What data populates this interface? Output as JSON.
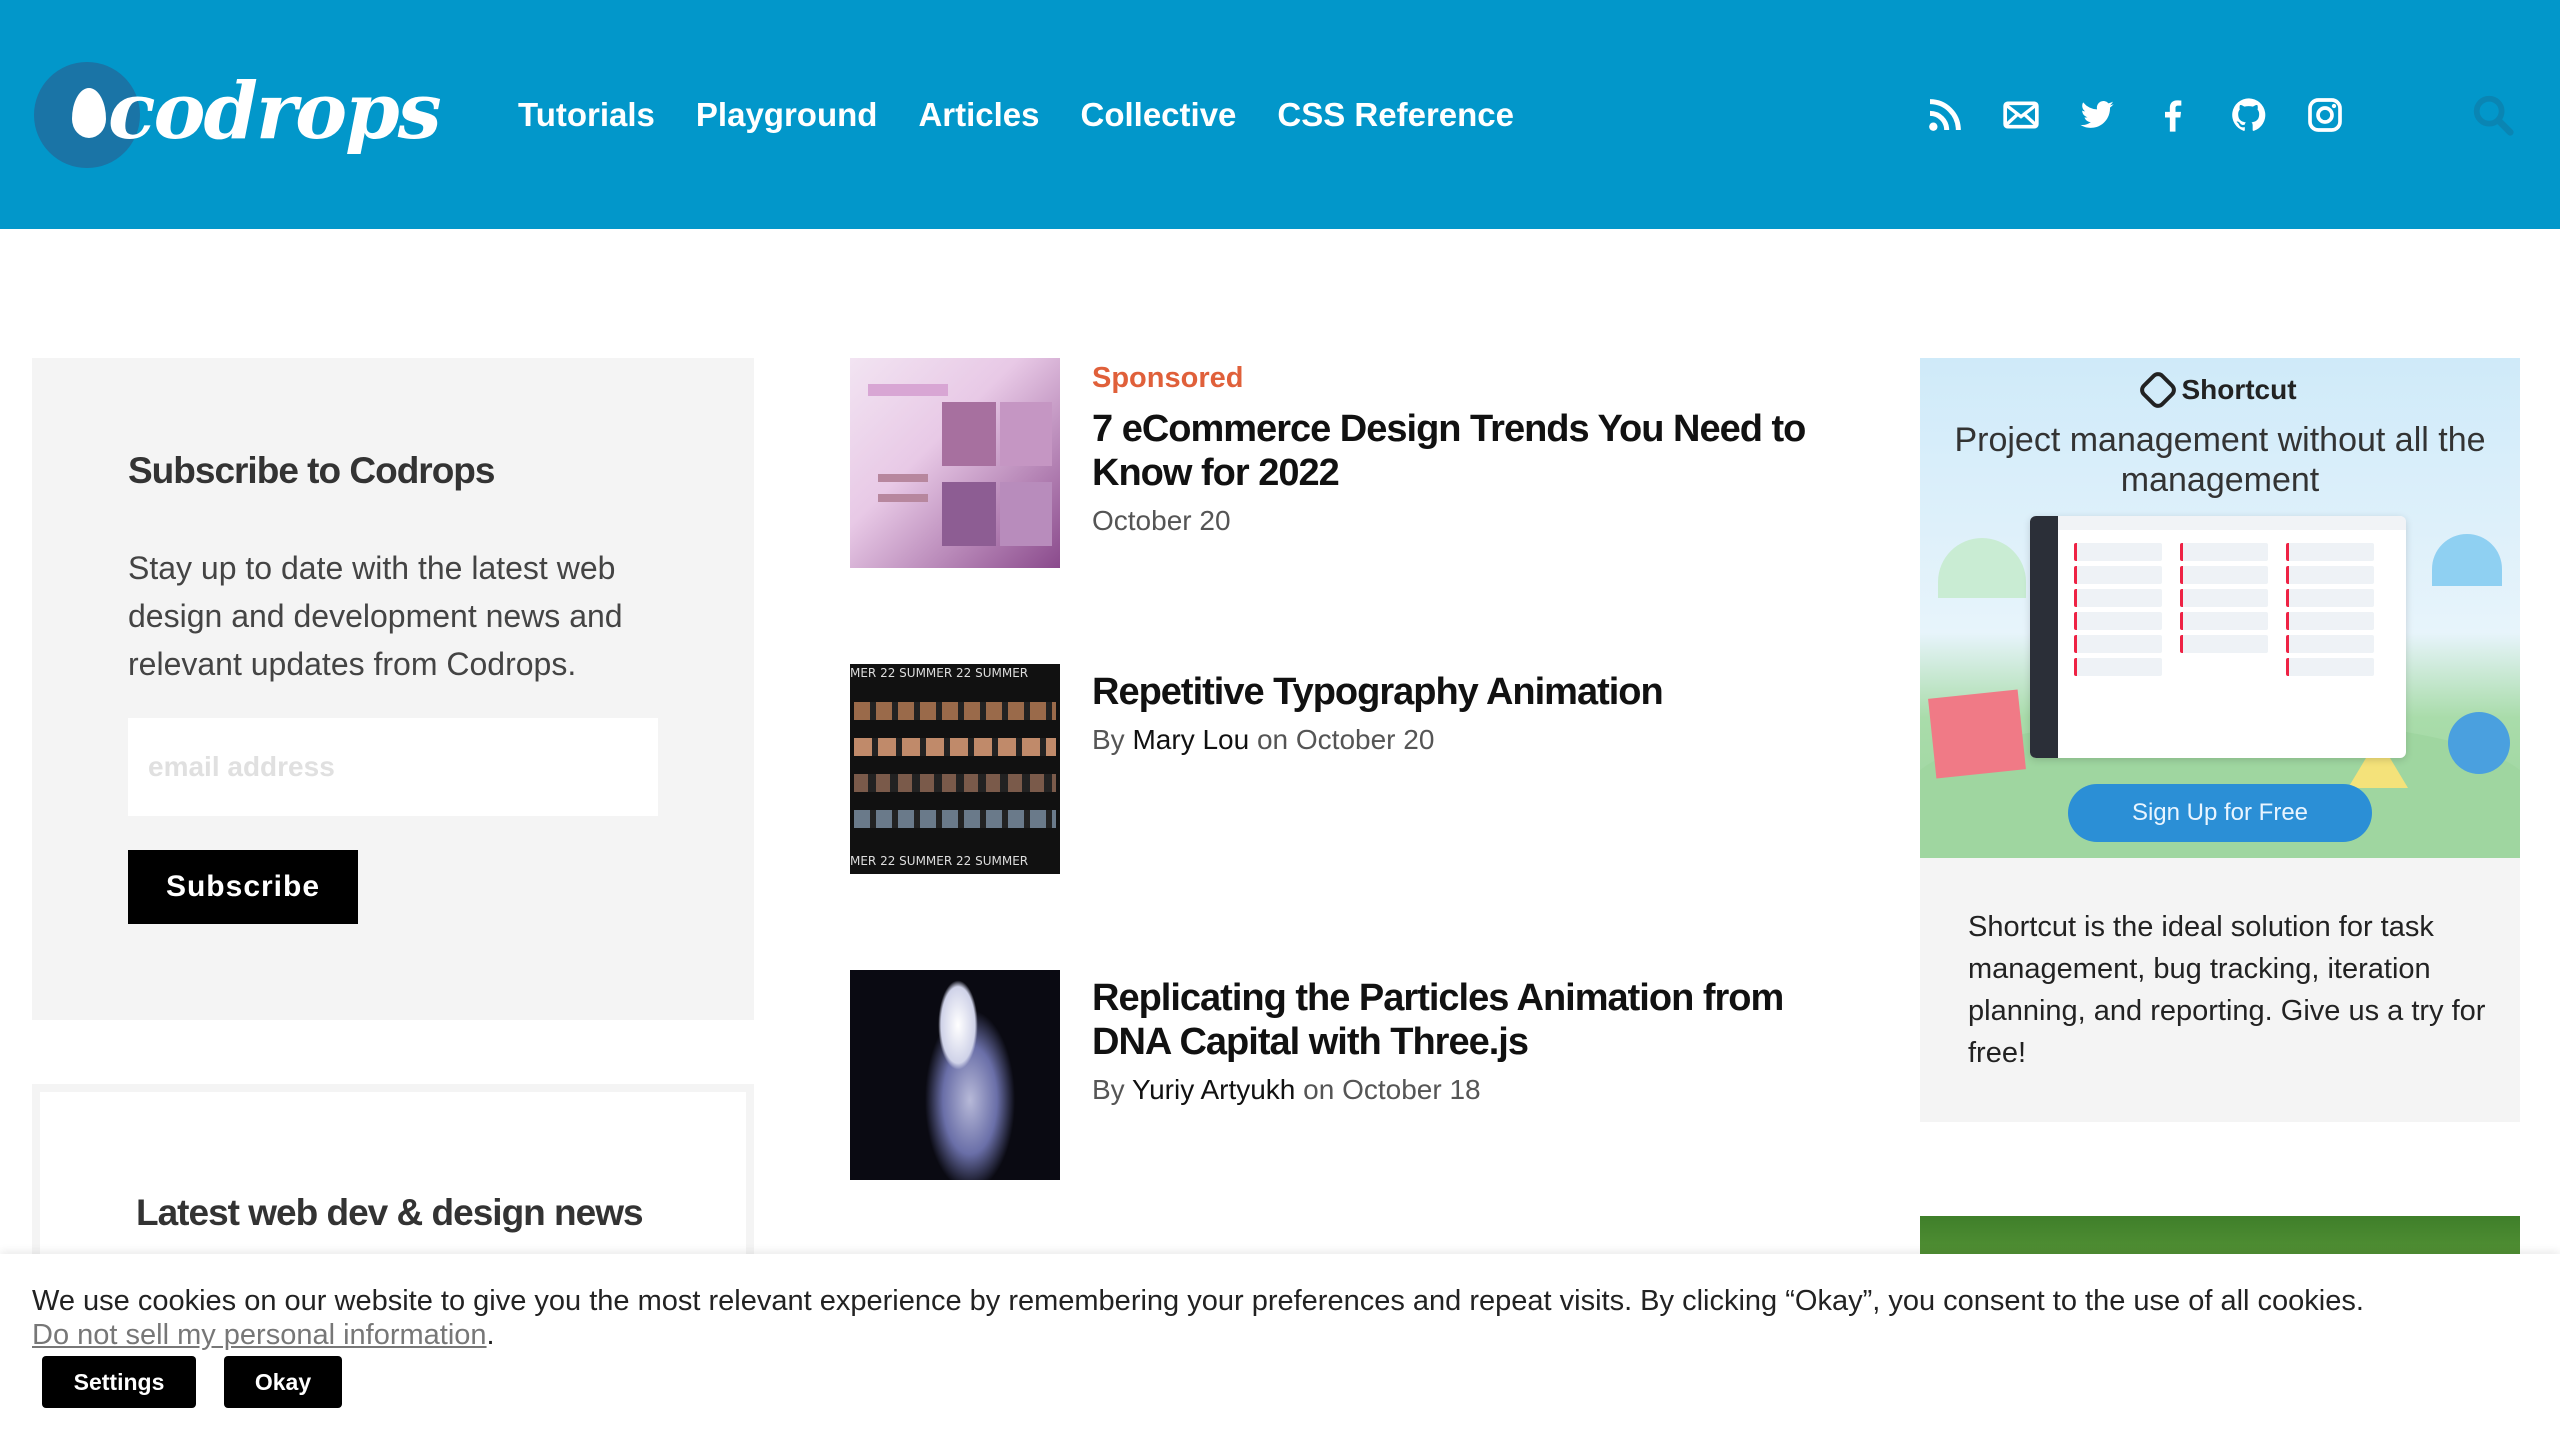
{
  "header": {
    "logo_text": "codrops",
    "nav": [
      "Tutorials",
      "Playground",
      "Articles",
      "Collective",
      "CSS Reference"
    ],
    "social_icons": [
      "rss-icon",
      "mail-icon",
      "twitter-icon",
      "facebook-icon",
      "github-icon",
      "instagram-icon"
    ],
    "search_icon": "search-icon",
    "bg_color": "#0297ca"
  },
  "subscribe": {
    "title": "Subscribe to Codrops",
    "description": "Stay up to date with the latest web design and development news and relevant updates from Codrops.",
    "email_placeholder": "email address",
    "button": "Subscribe"
  },
  "news": {
    "title": "Latest web dev & design news"
  },
  "articles": [
    {
      "label": "Sponsored",
      "title": "7 eCommerce Design Trends You Need to Know for 2022",
      "date": "October 20"
    },
    {
      "title": "Repetitive Typography Animation",
      "by": "By",
      "author": "Mary Lou",
      "on": "on",
      "date": "October 20"
    },
    {
      "title": "Replicating the Particles Animation from DNA Capital with Three.js",
      "by": "By",
      "author": "Yuriy Artyukh",
      "on": "on",
      "date": "October 18"
    }
  ],
  "thumb1_text": "MER 22  SUMMER 22  SUMMER",
  "ad": {
    "brand": "Shortcut",
    "headline": "Project management without all the management",
    "cta": "Sign Up for Free",
    "text": "Shortcut is the ideal solution for task management, bug tracking, iteration planning, and reporting. Give us a try for free!"
  },
  "cookie": {
    "text": "We use cookies on our website to give you the most relevant experience by remembering your preferences and repeat visits. By clicking “Okay”, you consent to the use of all cookies.",
    "link": "Do not sell my personal information",
    "period": ".",
    "settings": "Settings",
    "okay": "Okay"
  }
}
